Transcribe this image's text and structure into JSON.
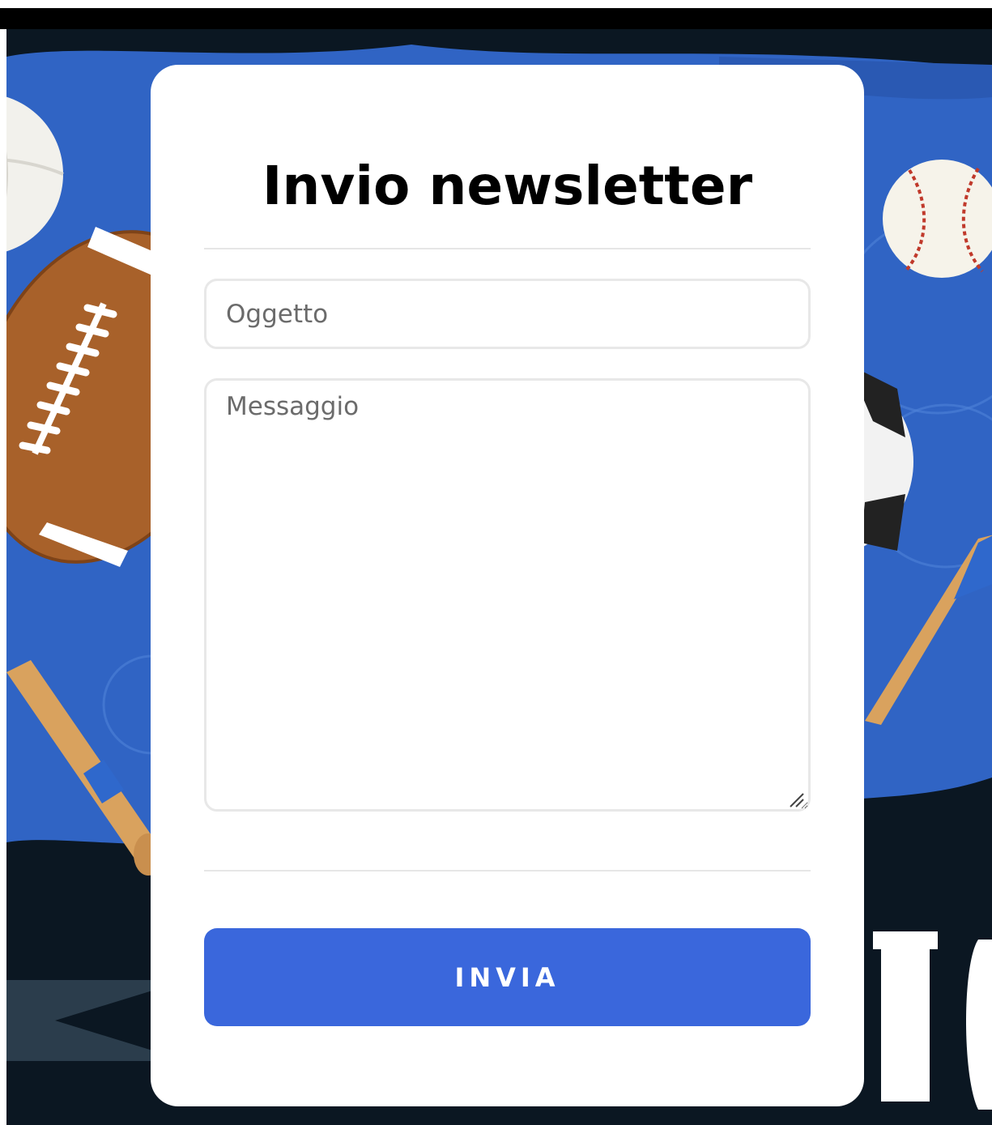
{
  "form": {
    "title": "Invio newsletter",
    "subject_placeholder": "Oggetto",
    "message_placeholder": "Messaggio",
    "submit_label": "INVIA"
  },
  "colors": {
    "background_dark": "#0b1722",
    "background_blue": "#3064c4",
    "card": "#ffffff",
    "button": "#3a67dc",
    "button_text": "#ffffff",
    "border": "#e8e8e8"
  },
  "icons": [
    "american-football-icon",
    "volleyball-icon",
    "baseball-icon",
    "soccer-ball-icon",
    "baseball-bat-icon",
    "resize-grip-icon"
  ]
}
